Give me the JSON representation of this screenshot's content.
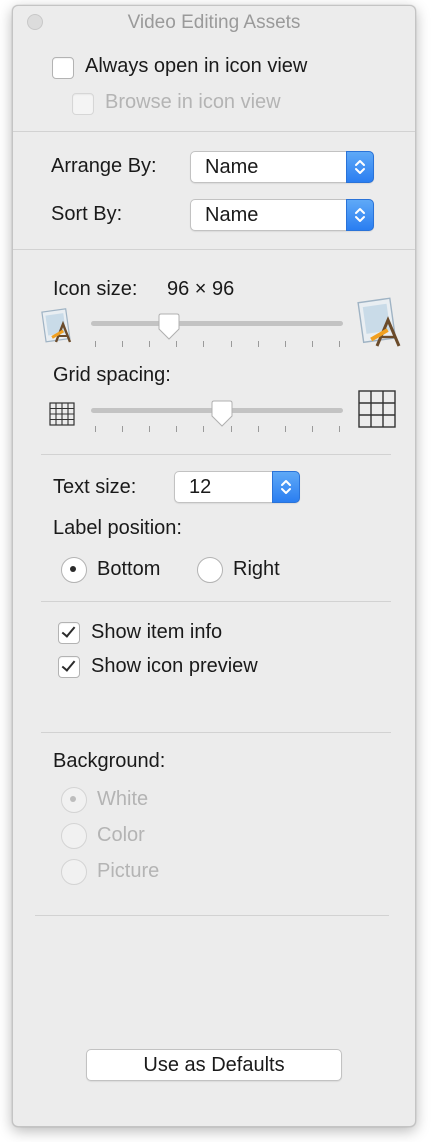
{
  "window": {
    "title": "Video Editing Assets"
  },
  "view_options": {
    "always_open_icon_view": {
      "label": "Always open in icon view",
      "checked": false
    },
    "browse_icon_view": {
      "label": "Browse in icon view",
      "checked": false,
      "enabled": false
    }
  },
  "arrange": {
    "arrange_by_label": "Arrange By:",
    "arrange_by_value": "Name",
    "sort_by_label": "Sort By:",
    "sort_by_value": "Name"
  },
  "icon_size": {
    "label": "Icon size:",
    "value_text": "96 × 96",
    "level": 0.31,
    "small_icon": "app-icon",
    "large_icon": "app-icon"
  },
  "grid_spacing": {
    "label": "Grid spacing:",
    "level": 0.52,
    "small_icon": "grid-small-icon",
    "large_icon": "grid-large-icon"
  },
  "text": {
    "text_size_label": "Text size:",
    "text_size_value": "12",
    "label_position_label": "Label position:",
    "bottom_label": "Bottom",
    "right_label": "Right",
    "selected_position": "Bottom"
  },
  "info": {
    "show_item_info": {
      "label": "Show item info",
      "checked": true
    },
    "show_icon_preview": {
      "label": "Show icon preview",
      "checked": true
    }
  },
  "background": {
    "label": "Background:",
    "options": [
      "White",
      "Color",
      "Picture"
    ],
    "selected": "White",
    "enabled": false
  },
  "footer": {
    "defaults_button": "Use as Defaults"
  },
  "colors": {
    "accent": "#2a7ef1",
    "window_bg": "#ececec",
    "disabled_text": "#b4b4b4"
  }
}
